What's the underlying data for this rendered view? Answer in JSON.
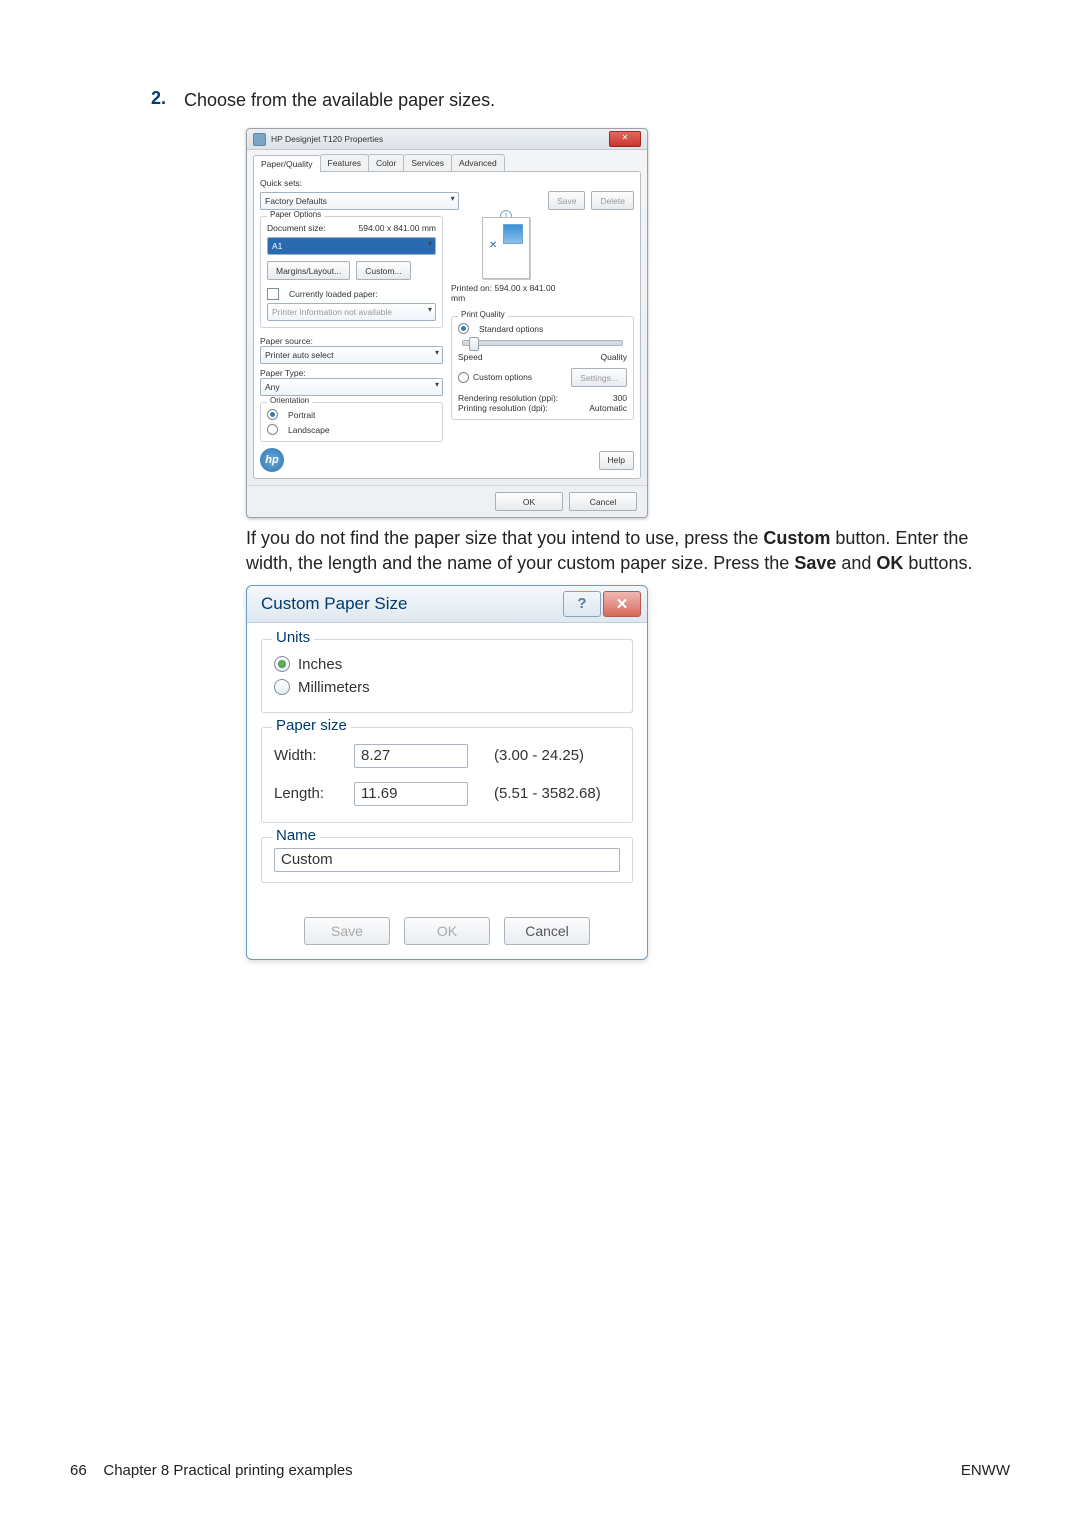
{
  "step": {
    "num": "2.",
    "text": "Choose from the available paper sizes."
  },
  "props": {
    "title": "HP Designjet T120 Properties",
    "tabs": [
      "Paper/Quality",
      "Features",
      "Color",
      "Services",
      "Advanced"
    ],
    "quick_sets_label": "Quick sets:",
    "quick_sets_value": "Factory Defaults",
    "save": "Save",
    "delete": "Delete",
    "paper_options": "Paper Options",
    "doc_size_label": "Document size:",
    "doc_size_value": "594.00 x 841.00 mm",
    "paper_size_value": "A1",
    "margins": "Margins/Layout...",
    "custom": "Custom...",
    "loaded_paper": "Currently loaded paper:",
    "printer_info": "Printer Information not available",
    "printed_on": "Printed on: 594.00 x 841.00 mm",
    "print_quality": "Print Quality",
    "standard_options": "Standard options",
    "speed": "Speed",
    "quality": "Quality",
    "custom_options": "Custom options",
    "settings": "Settings...",
    "paper_source_label": "Paper source:",
    "paper_source_value": "Printer auto select",
    "paper_type_label": "Paper Type:",
    "paper_type_value": "Any",
    "orientation": "Orientation",
    "portrait": "Portrait",
    "landscape": "Landscape",
    "render_label": "Rendering resolution (ppi):",
    "render_value": "300",
    "print_res_label": "Printing resolution (dpi):",
    "print_res_value": "Automatic",
    "help": "Help",
    "ok": "OK",
    "cancel": "Cancel"
  },
  "para": {
    "t1": "If you do not find the paper size that you intend to use, press the ",
    "b1": "Custom",
    "t2": " button. Enter the width, the length and the name of your custom paper size. Press the ",
    "b2": "Save",
    "t3": " and ",
    "b3": "OK",
    "t4": " buttons."
  },
  "dlg": {
    "title": "Custom Paper Size",
    "units": "Units",
    "inches": "Inches",
    "mm": "Millimeters",
    "paper_size": "Paper size",
    "width_label": "Width:",
    "width_value": "8.27",
    "width_range": "(3.00 - 24.25)",
    "length_label": "Length:",
    "length_value": "11.69",
    "length_range": "(5.51 - 3582.68)",
    "name_label": "Name",
    "name_value": "Custom",
    "save": "Save",
    "ok": "OK",
    "cancel": "Cancel"
  },
  "footer": {
    "page": "66",
    "chapter": "Chapter 8   Practical printing examples",
    "right": "ENWW"
  }
}
